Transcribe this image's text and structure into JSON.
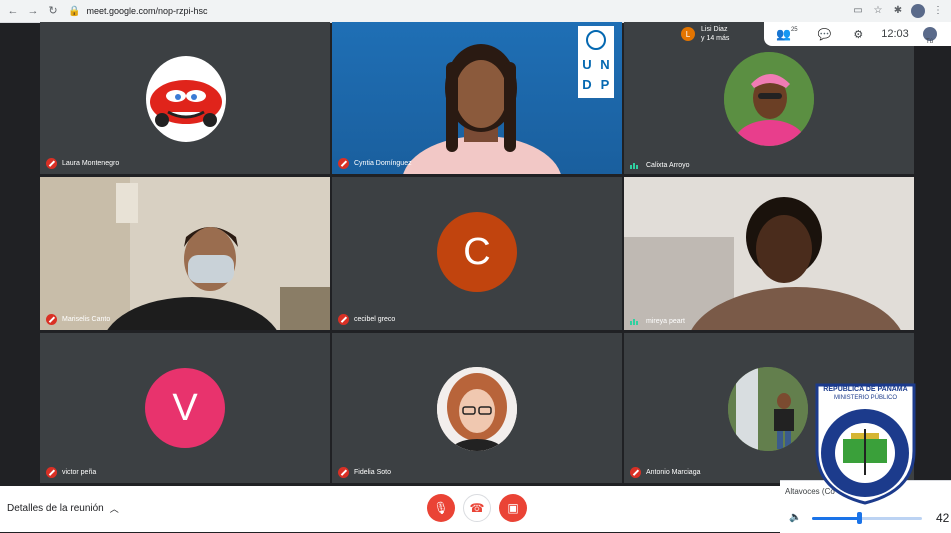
{
  "browser": {
    "url": "meet.google.com/nop-rzpi-hsc"
  },
  "notification": {
    "initial": "L",
    "line1": "Lisi Diaz",
    "line2": "y 14 más"
  },
  "top_pill": {
    "participants_count": "25",
    "time": "12:03",
    "you_label": "Tú"
  },
  "tiles": [
    {
      "name": "Laura Montenegro",
      "muted": true
    },
    {
      "name": "Cyntia Domínguez",
      "muted": true,
      "logo_text": [
        "U",
        "N",
        "D",
        "P"
      ]
    },
    {
      "name": "Calixta Arroyo",
      "muted": false
    },
    {
      "name": "Mariselis Canto",
      "muted": true
    },
    {
      "name": "cecibel greco",
      "muted": true,
      "initial": "C",
      "color": "#c1440e"
    },
    {
      "name": "mireya peart",
      "muted": false
    },
    {
      "name": "victor peña",
      "muted": true,
      "initial": "V",
      "color": "#e8336d"
    },
    {
      "name": "Fidelia Soto",
      "muted": true
    },
    {
      "name": "Antonio Marciaga",
      "muted": true
    }
  ],
  "bottom": {
    "details_label": "Detalles de la reunión"
  },
  "speaker": {
    "label": "Altavoces (Co",
    "volume": "42"
  },
  "emblem": {
    "top_text_1": "REPÚBLICA DE PANAMÁ",
    "top_text_2": "MINISTERIO PÚBLICO",
    "ring_text": "INSTITUTO DE MEDICINA LEGAL Y CIENCIAS FORENSES"
  },
  "colors": {
    "accent_red": "#ea4335",
    "meet_bg": "#202124",
    "tile_bg": "#3c4043"
  }
}
